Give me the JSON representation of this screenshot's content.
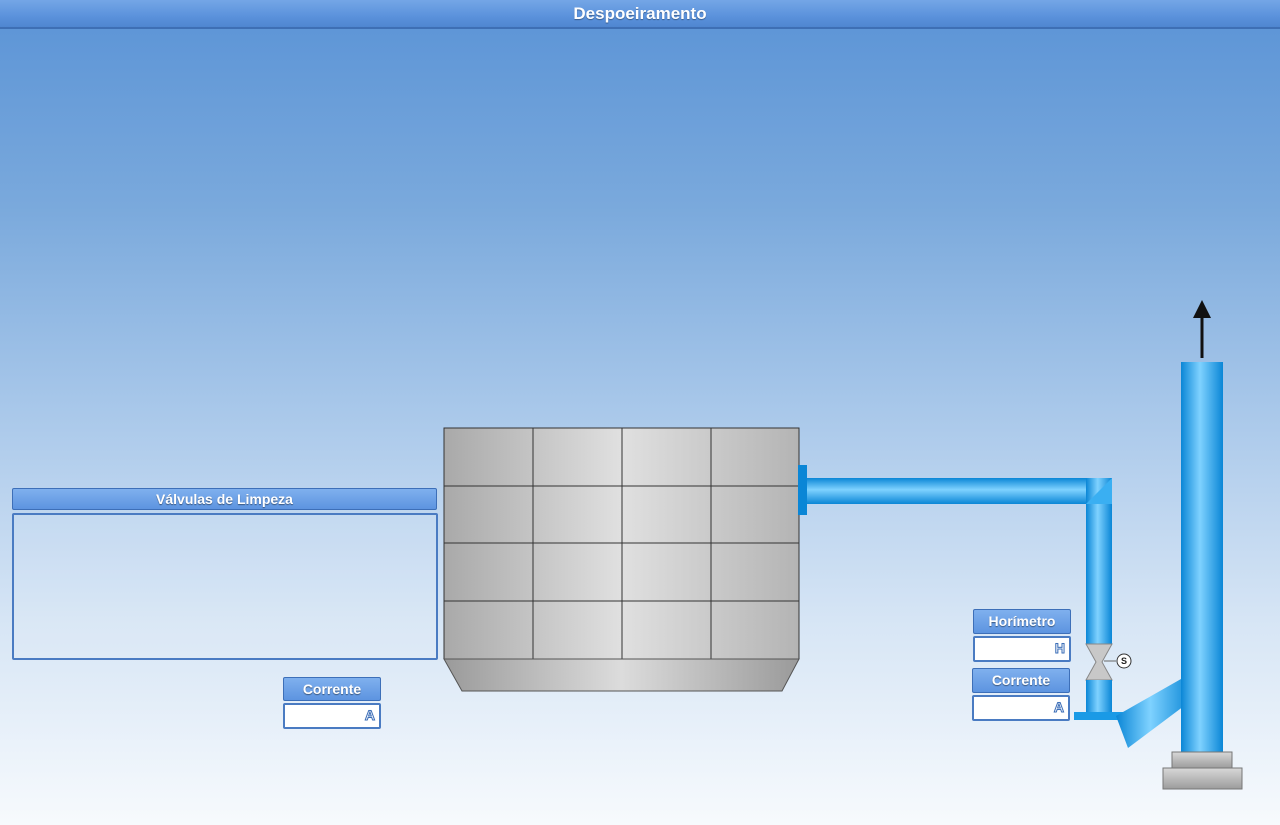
{
  "window": {
    "title": "Despoeiramento"
  },
  "cleaning_valves": {
    "label": "Válvulas de Limpeza"
  },
  "filter_current": {
    "label": "Corrente",
    "unit": "A"
  },
  "fan_hourmeter": {
    "label": "Horímetro",
    "unit": "H"
  },
  "fan_current": {
    "label": "Corrente",
    "unit": "A"
  },
  "fan_status_badge": "S",
  "colors": {
    "pipe": "#1aa3f0",
    "header": "#5b92dc",
    "filter": "#c8c8c8"
  }
}
